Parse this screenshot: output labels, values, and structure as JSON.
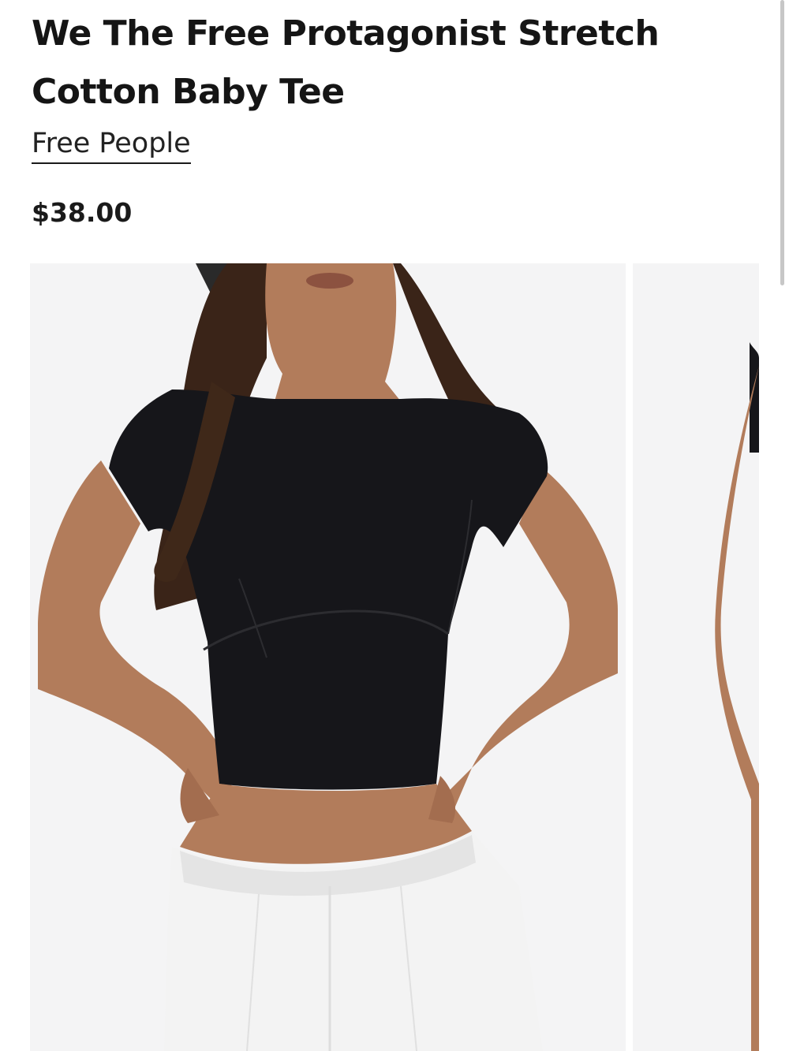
{
  "product": {
    "title": "We The Free Protagonist Stretch Cotton Baby Tee",
    "brand": "Free People",
    "price": "$38.00"
  },
  "gallery": {
    "images": [
      {
        "alt": "Model wearing black cropped baby tee with white pants, hands on hips"
      },
      {
        "alt": "Side view of model wearing black cropped baby tee"
      }
    ]
  },
  "colors": {
    "text": "#151515",
    "photo_background": "#f4f4f5",
    "tee": "#16161a",
    "skin": "#b27c5b",
    "hair": "#3a2418",
    "pants": "#f3f3f3"
  }
}
